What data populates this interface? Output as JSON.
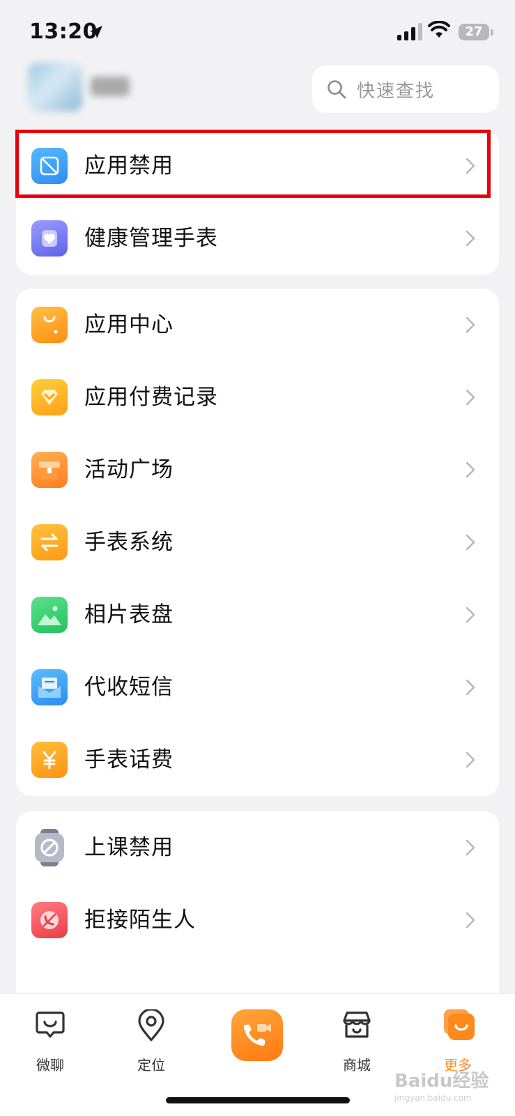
{
  "status_bar": {
    "time": "13:20",
    "battery": "27"
  },
  "header": {
    "search_placeholder": "快速查找"
  },
  "groups": [
    {
      "items": [
        {
          "label": "应用禁用",
          "icon": "app-block-icon",
          "color": "#3aa2f5"
        },
        {
          "label": "健康管理手表",
          "icon": "heart-watch-icon",
          "color": "#6f73f0"
        }
      ]
    },
    {
      "items": [
        {
          "label": "应用中心",
          "icon": "shopping-bag-icon",
          "color": "#ffa01f"
        },
        {
          "label": "应用付费记录",
          "icon": "diamond-icon",
          "color": "#ffb21c"
        },
        {
          "label": "活动广场",
          "icon": "gift-icon",
          "color": "#ff8c22"
        },
        {
          "label": "手表系统",
          "icon": "swap-icon",
          "color": "#ffa91f"
        },
        {
          "label": "相片表盘",
          "icon": "photo-icon",
          "color": "#34d06f"
        },
        {
          "label": "代收短信",
          "icon": "mail-icon",
          "color": "#2f9af0"
        },
        {
          "label": "手表话费",
          "icon": "yuan-icon",
          "color": "#ff9c1a"
        }
      ]
    },
    {
      "items": [
        {
          "label": "上课禁用",
          "icon": "class-ban-icon",
          "color": "#8e93a0"
        },
        {
          "label": "拒接陌生人",
          "icon": "reject-call-icon",
          "color": "#f0535b"
        }
      ]
    }
  ],
  "tabbar": {
    "tabs": [
      {
        "label": "微聊",
        "icon": "chat-icon"
      },
      {
        "label": "定位",
        "icon": "location-icon"
      },
      {
        "label": "",
        "icon": "video-call-icon"
      },
      {
        "label": "商城",
        "icon": "store-icon"
      },
      {
        "label": "更多",
        "icon": "more-icon"
      }
    ],
    "active_color": "#ff8a1c"
  },
  "watermark": {
    "text": "Baidu经验",
    "sub": "jingyan.baidu.com"
  }
}
